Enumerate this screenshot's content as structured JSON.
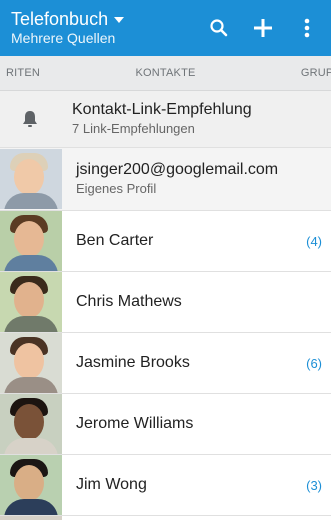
{
  "header": {
    "title": "Telefonbuch",
    "subtitle": "Mehrere Quellen",
    "background": "#1c8fd6"
  },
  "tabs": {
    "left": "RITEN",
    "center": "KONTAKTE",
    "right": "GRUPP"
  },
  "notification": {
    "title": "Kontakt-Link-Empfehlung",
    "subtitle": "7 Link-Empfehlungen",
    "icon": "bell-icon"
  },
  "profile": {
    "name": "jsinger200@googlemail.com",
    "subtitle": "Eigenes Profil"
  },
  "contacts": [
    {
      "name": "Ben Carter",
      "count": "(4)"
    },
    {
      "name": "Chris Mathews",
      "count": ""
    },
    {
      "name": "Jasmine Brooks",
      "count": "(6)"
    },
    {
      "name": "Jerome Williams",
      "count": ""
    },
    {
      "name": "Jim Wong",
      "count": "(3)"
    }
  ],
  "colors": {
    "accent": "#1c8fd6",
    "tab_bg": "#e9eaeb"
  }
}
